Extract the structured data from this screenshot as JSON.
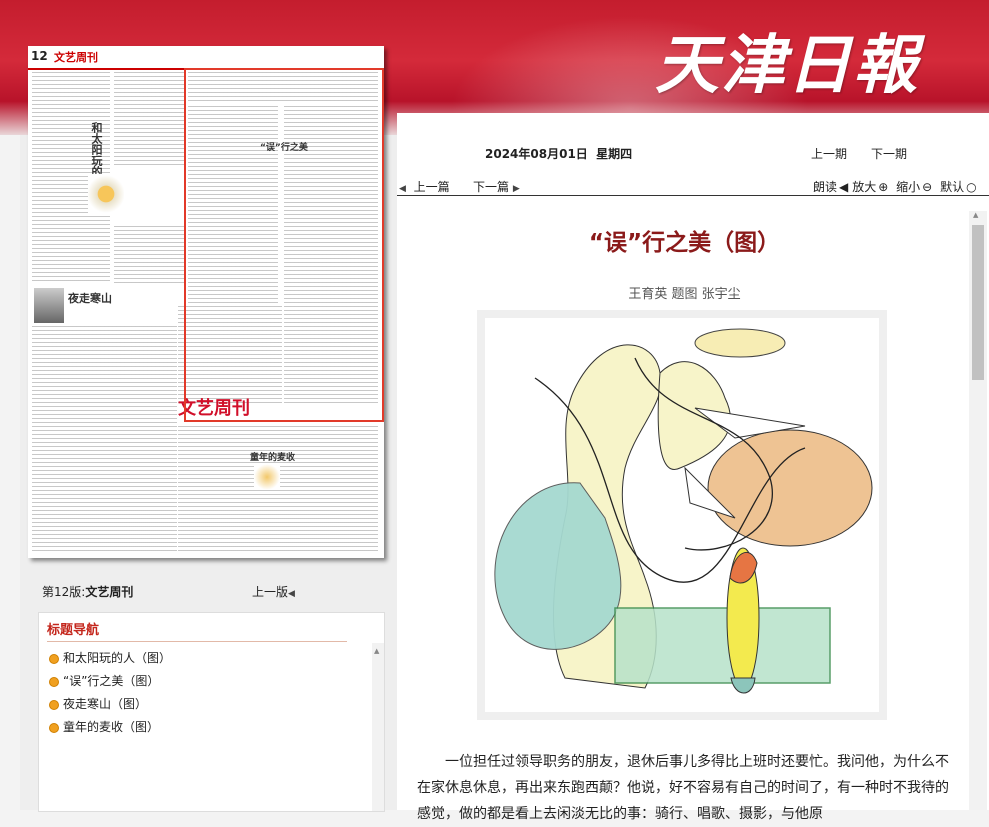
{
  "brand": "天津日報",
  "paper": {
    "edition_num": "12",
    "edition_name": "文艺周刊",
    "thumb_titles": [
      "和太阳玩的人",
      "夜走寒山",
      "童年的麦收",
      "“误”行之美",
      "文艺周刊"
    ]
  },
  "edition_caption": {
    "label": "第12版:",
    "name": "文艺周刊"
  },
  "prev_edition": "上一版",
  "nav": {
    "title": "标题导航",
    "items": [
      "和太阳玩的人（图）",
      "“误”行之美（图）",
      "夜走寒山（图）",
      "童年的麦收（图）"
    ]
  },
  "header": {
    "date": "2024年08月01日",
    "weekday": "星期四",
    "prev_issue": "上一期",
    "next_issue": "下一期"
  },
  "toolbar": {
    "prev_article": "上一篇",
    "next_article": "下一篇",
    "read": "朗读",
    "zoom_in": "放大",
    "zoom_out": "缩小",
    "default": "默认"
  },
  "article": {
    "title": "“误”行之美（图）",
    "byline": "王育英  题图  张宇尘",
    "body": "一位担任过领导职务的朋友，退休后事儿多得比上班时还要忙。我问他，为什么不在家休息休息，再出来东跑西颠？他说，好不容易有自己的时间了，有一种时不我待的感觉，做的都是看上去闲淡无比的事：骑行、唱歌、摄影，与他原"
  }
}
